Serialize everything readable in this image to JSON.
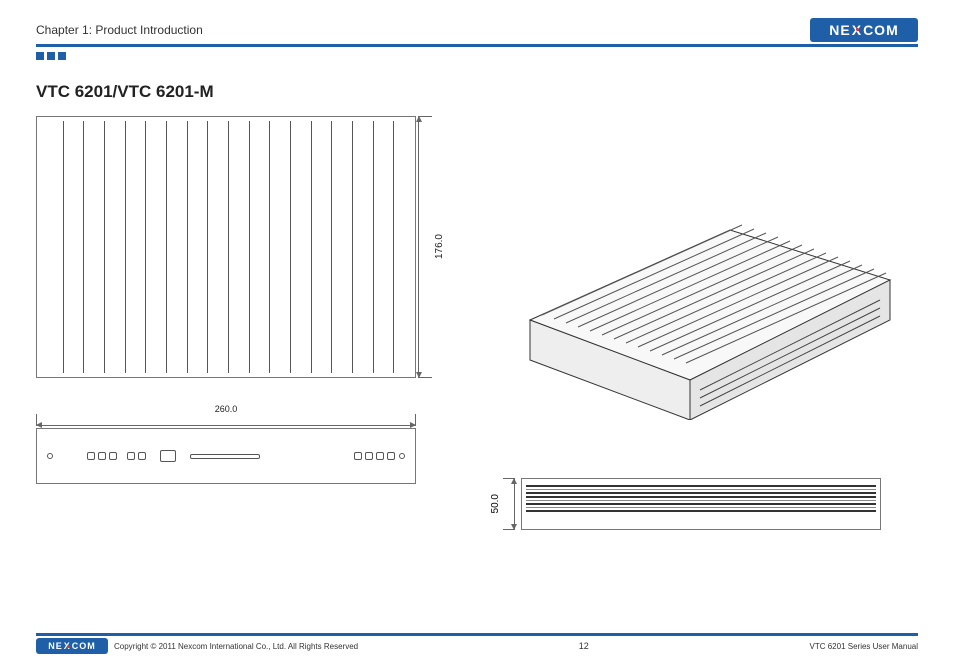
{
  "header": {
    "chapter": "Chapter 1: Product Introduction",
    "brand": "NEXCOM"
  },
  "section": {
    "title": "VTC 6201/VTC 6201-M"
  },
  "dimensions": {
    "height_mm": "176.0",
    "width_mm": "260.0",
    "depth_mm": "50.0"
  },
  "footer": {
    "copyright": "Copyright © 2011 Nexcom International Co., Ltd. All Rights Reserved",
    "page": "12",
    "doc": "VTC 6201 Series User Manual",
    "brand": "NEXCOM"
  }
}
